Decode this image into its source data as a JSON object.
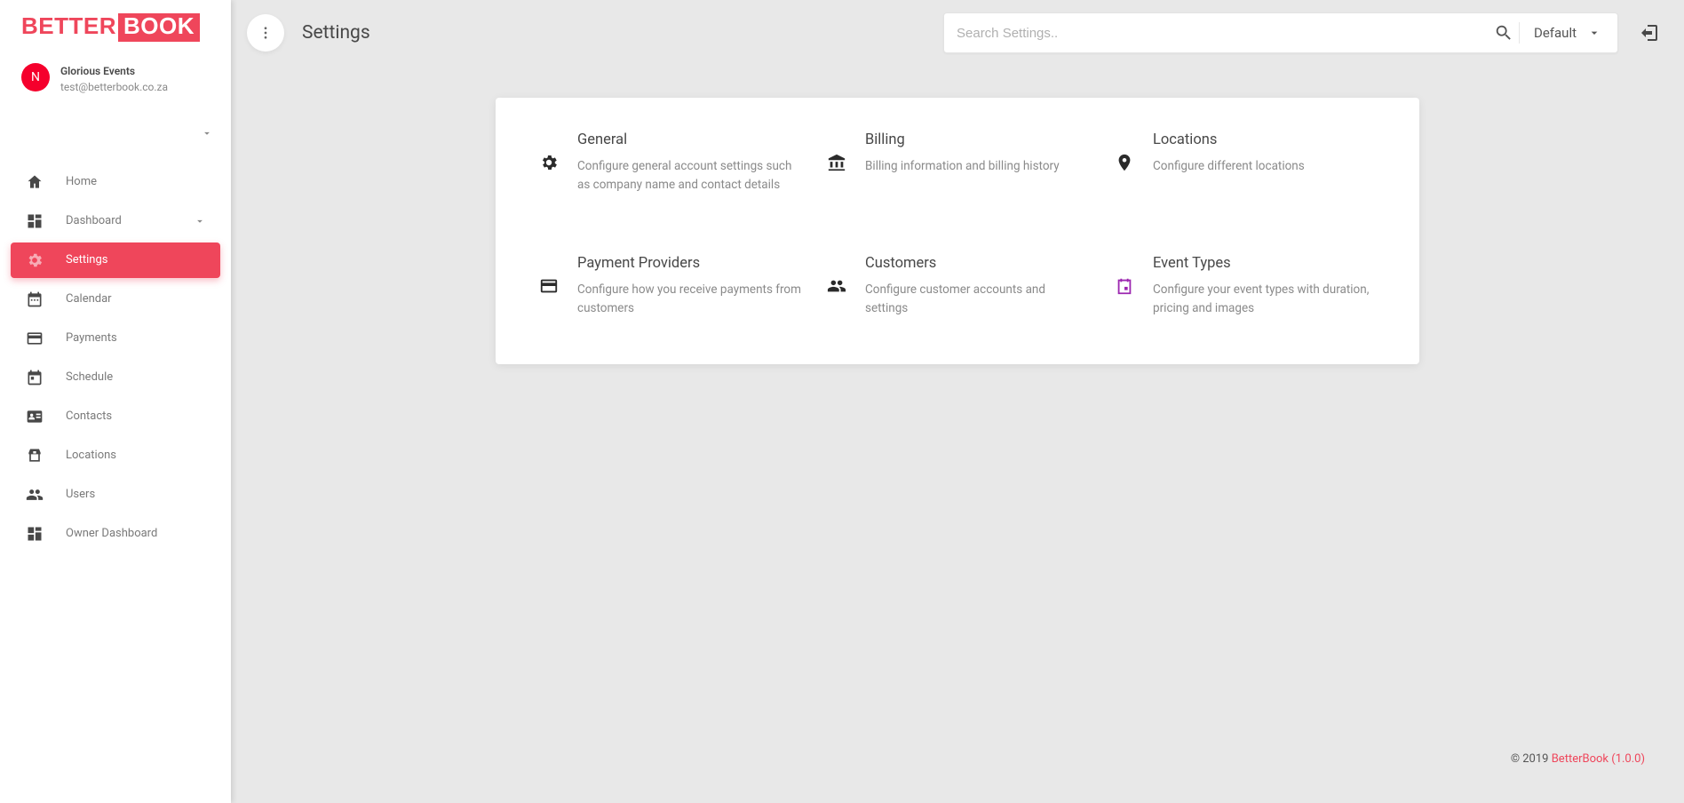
{
  "logo": {
    "left": "BETTER",
    "right": "BOOK"
  },
  "account": {
    "initial": "N",
    "name": "Glorious Events",
    "email": "test@betterbook.co.za"
  },
  "nav": [
    {
      "icon": "home",
      "label": "Home"
    },
    {
      "icon": "dashboard",
      "label": "Dashboard",
      "caret": true
    },
    {
      "icon": "settings",
      "label": "Settings",
      "active": true
    },
    {
      "icon": "calendar",
      "label": "Calendar"
    },
    {
      "icon": "card",
      "label": "Payments"
    },
    {
      "icon": "schedule",
      "label": "Schedule"
    },
    {
      "icon": "contact",
      "label": "Contacts"
    },
    {
      "icon": "store",
      "label": "Locations"
    },
    {
      "icon": "users",
      "label": "Users"
    },
    {
      "icon": "dashboard",
      "label": "Owner Dashboard"
    }
  ],
  "header": {
    "title": "Settings",
    "search_placeholder": "Search Settings..",
    "filter_label": "Default"
  },
  "tiles": [
    {
      "icon": "settings",
      "title": "General",
      "desc": "Configure general account settings such as company name and contact details"
    },
    {
      "icon": "bank",
      "title": "Billing",
      "desc": "Billing information and billing history"
    },
    {
      "icon": "pin",
      "title": "Locations",
      "desc": "Configure different locations"
    },
    {
      "icon": "card",
      "title": "Payment Providers",
      "desc": "Configure how you receive payments from customers"
    },
    {
      "icon": "users",
      "title": "Customers",
      "desc": "Configure customer accounts and settings"
    },
    {
      "icon": "event",
      "title": "Event Types",
      "desc": "Configure your event types with duration, pricing and images",
      "accent": true
    }
  ],
  "footer": {
    "copy": "© 2019 ",
    "link": "BetterBook (1.0.0)"
  }
}
